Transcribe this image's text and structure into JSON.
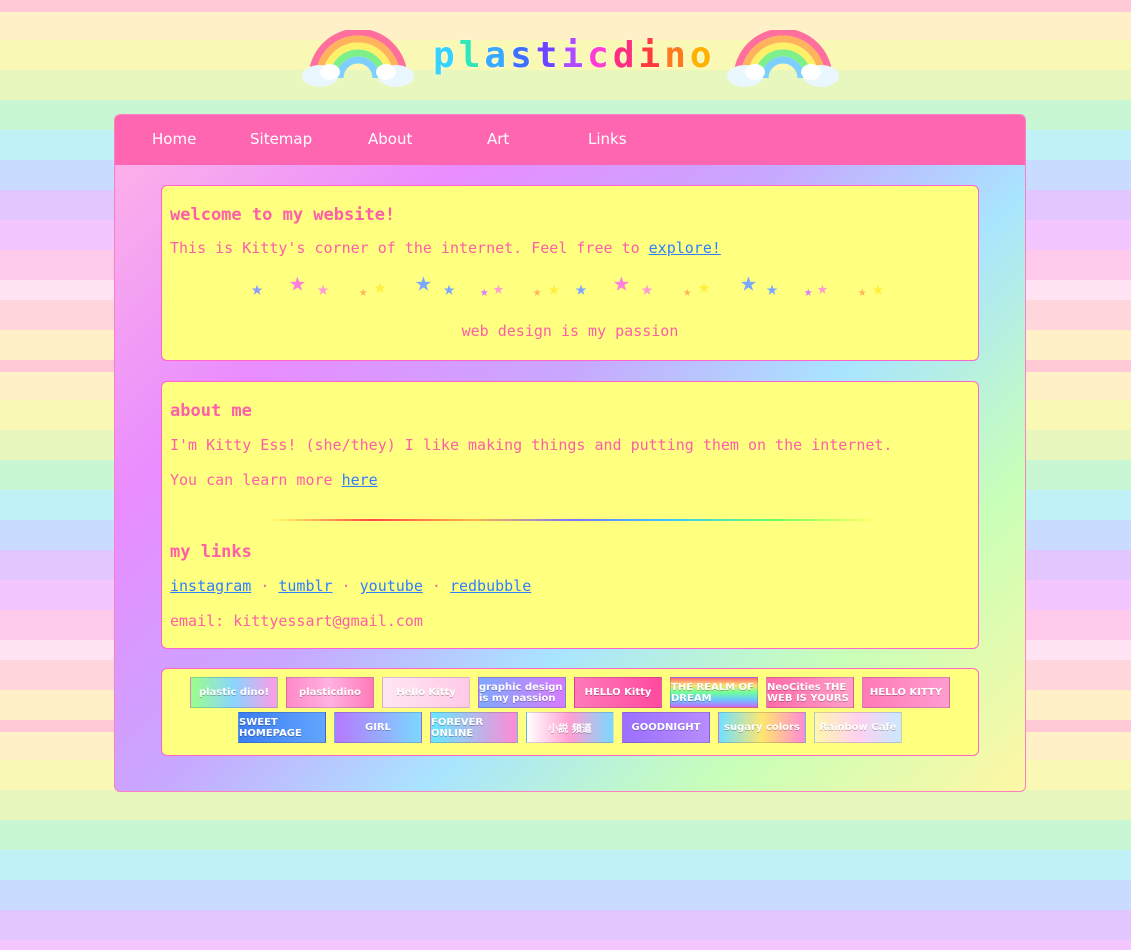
{
  "logo": {
    "text": "plasticdino",
    "letters": [
      {
        "ch": "p",
        "color": "#37d2ff"
      },
      {
        "ch": "l",
        "color": "#31e6b7"
      },
      {
        "ch": "a",
        "color": "#3aa8ff"
      },
      {
        "ch": "s",
        "color": "#3f6fff"
      },
      {
        "ch": "t",
        "color": "#6b45ff"
      },
      {
        "ch": "i",
        "color": "#b14bff"
      },
      {
        "ch": "c",
        "color": "#ff3dd4"
      },
      {
        "ch": "d",
        "color": "#ff2f7f"
      },
      {
        "ch": "i",
        "color": "#ff3b3b"
      },
      {
        "ch": "n",
        "color": "#ff7a1f"
      },
      {
        "ch": "o",
        "color": "#ffb000"
      }
    ]
  },
  "nav": {
    "items": [
      "Home",
      "Sitemap",
      "About",
      "Art",
      "Links"
    ]
  },
  "welcome": {
    "title": "welcome to my website!",
    "text": "This is Kitty's corner of the internet. Feel free to ",
    "link": "explore!",
    "tagline": "web design is my passion"
  },
  "about": {
    "title": "about me",
    "line1": "I'm Kitty Ess! (she/they) I like making things and putting them on the internet.",
    "line2": "You can learn more ",
    "line2_link": "here"
  },
  "links": {
    "title": "my links",
    "items": [
      "instagram",
      "tumblr",
      "youtube",
      "redbubble"
    ],
    "separator": "·",
    "email": "email: kittyessart@gmail.com"
  },
  "buttons": [
    {
      "text": "plastic dino!",
      "bg": "linear-gradient(90deg,#9bff8a,#8ad4ff,#ff9ae6)"
    },
    {
      "text": "plasticdino",
      "bg": "linear-gradient(90deg,#ff8ac9,#ffb0e0,#ff7ab8)"
    },
    {
      "text": "Hello Kitty",
      "bg": "linear-gradient(90deg,#ffe6f3,#ffc9e6)"
    },
    {
      "text": "graphic design is my passion",
      "bg": "linear-gradient(90deg,#7fa8ff,#d77bff)"
    },
    {
      "text": "HELLO Kitty",
      "bg": "linear-gradient(90deg,#ff7ab8,#ff4aa0)"
    },
    {
      "text": "THE REALM OF DREAM",
      "bg": "linear-gradient(180deg,#ff6e6e,#ffe06e,#6eff9b,#6ec6ff,#c06eff)"
    },
    {
      "text": "NeoCities THE WEB IS YOURS",
      "bg": "linear-gradient(90deg,#ff6aa8,#ffa0c8)"
    },
    {
      "text": "HELLO KITTY",
      "bg": "linear-gradient(90deg,#ff7ab8,#ff9ccf)"
    },
    {
      "text": "SWEET HOMEPAGE",
      "bg": "linear-gradient(90deg,#3c7df0,#62a6ff)"
    },
    {
      "text": "GIRL",
      "bg": "linear-gradient(90deg,#b778ff,#7ad8ff)"
    },
    {
      "text": "FOREVER ONLINE",
      "bg": "linear-gradient(90deg,#67e7ff,#ff8ad6)"
    },
    {
      "text": "小説 頻道",
      "bg": "linear-gradient(90deg,#ffffff,#ff9fd2,#7ad8ff)"
    },
    {
      "text": "GOODNIGHT",
      "bg": "linear-gradient(90deg,#9a70ff,#b88cff)"
    },
    {
      "text": "sugary colors",
      "bg": "linear-gradient(90deg,#6fe0ff,#ffe66e,#ff8ad6)"
    },
    {
      "text": "Rainbow Cafe",
      "bg": "linear-gradient(90deg,#fff6b0,#ffd1f0,#c9e8ff)"
    }
  ]
}
